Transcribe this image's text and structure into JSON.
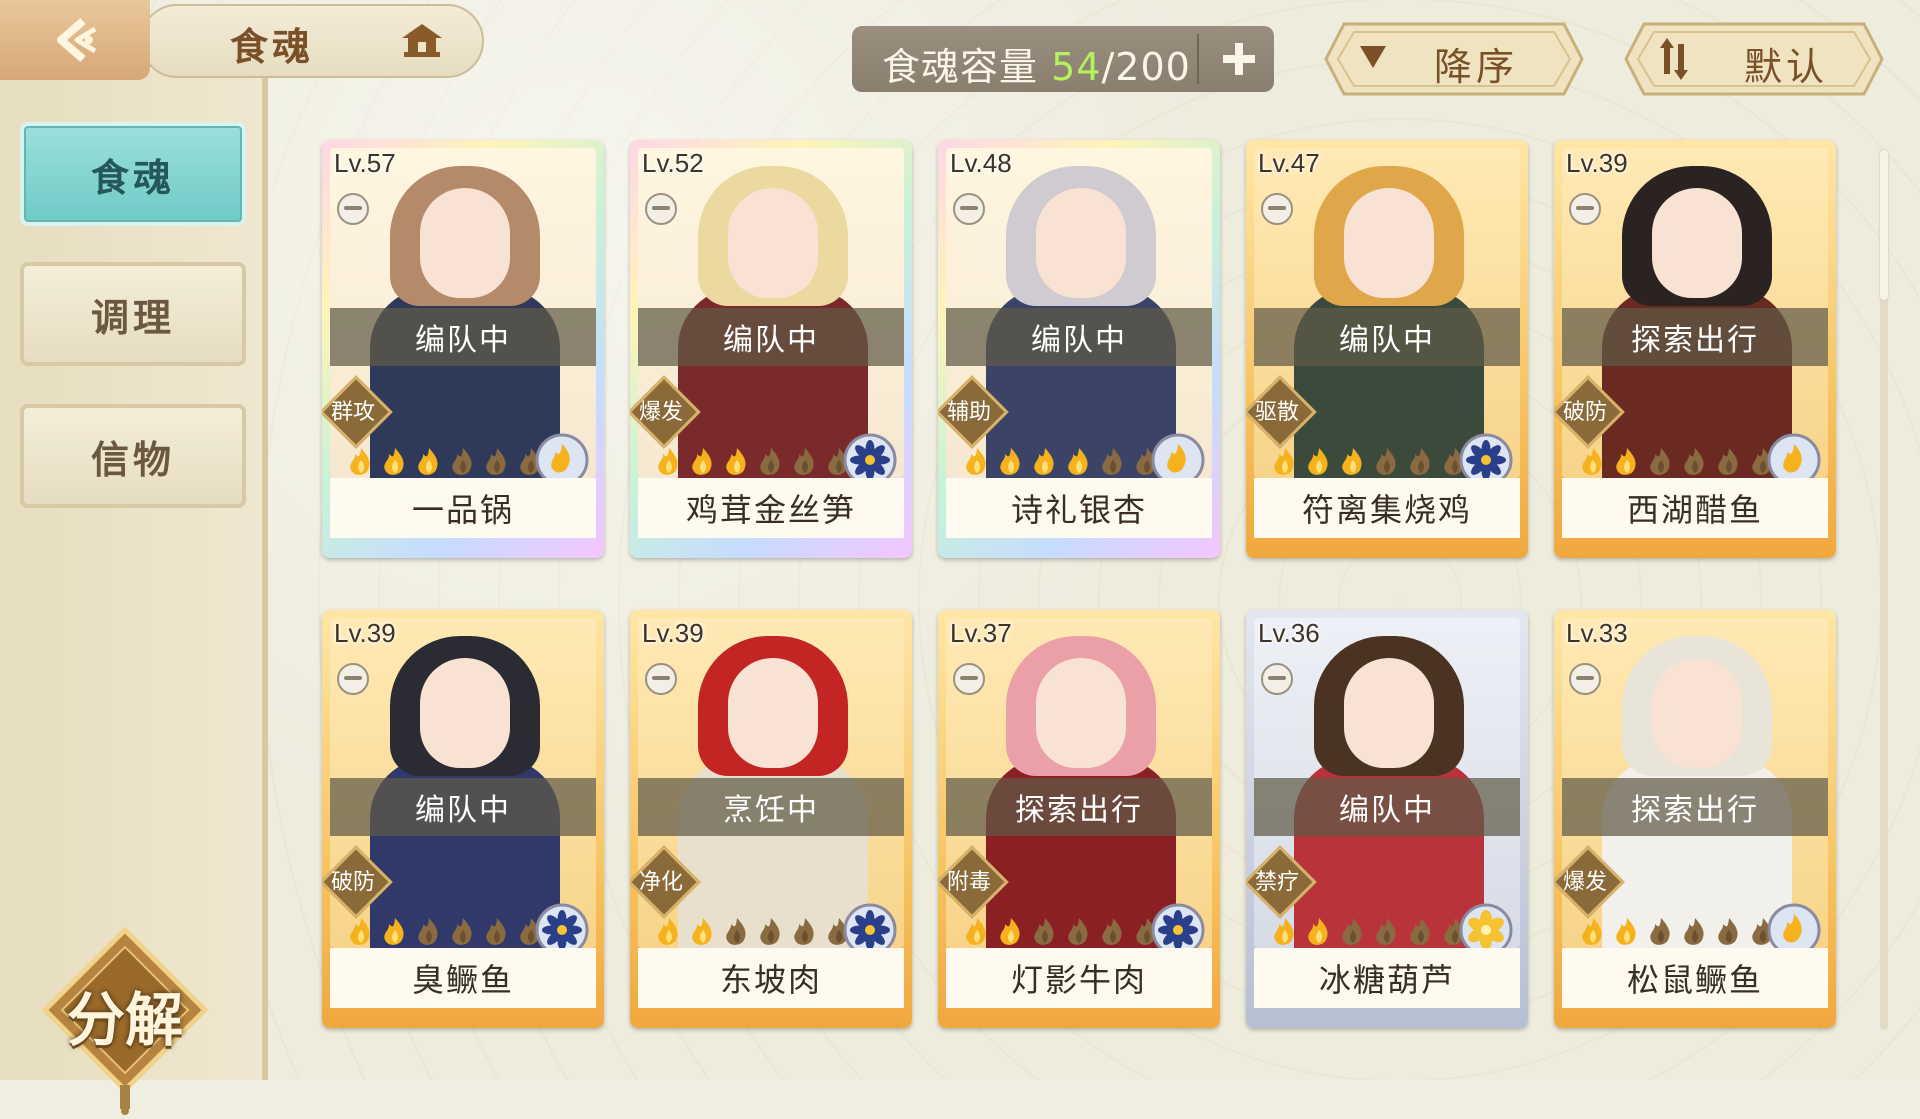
{
  "header": {
    "title": "食魂",
    "capacity_label": "食魂容量",
    "capacity_current": "54",
    "capacity_max": "/200",
    "sort_order_label": "降序",
    "sort_mode_label": "默认"
  },
  "sidebar": {
    "tabs": [
      {
        "label": "食魂",
        "active": true
      },
      {
        "label": "调理",
        "active": false
      },
      {
        "label": "信物",
        "active": false
      }
    ],
    "decompose_label": "分解"
  },
  "colors": {
    "accent_teal": "#6fcac4",
    "capacity_green": "#b3f25e",
    "brown_text": "#7a5028"
  },
  "cards": [
    {
      "level": "Lv.57",
      "status": "编队中",
      "role": "群攻",
      "name": "一品锅",
      "stars": 3,
      "rarity": "rainbow",
      "emblem": "flame",
      "hair": "#b48a6a",
      "outfit": "#2f3a5a"
    },
    {
      "level": "Lv.52",
      "status": "编队中",
      "role": "爆发",
      "name": "鸡茸金丝笋",
      "stars": 3,
      "rarity": "rainbow",
      "emblem": "flower",
      "hair": "#ecd9a0",
      "outfit": "#7a2a2a"
    },
    {
      "level": "Lv.48",
      "status": "编队中",
      "role": "辅助",
      "name": "诗礼银杏",
      "stars": 4,
      "rarity": "rainbow",
      "emblem": "flame",
      "hair": "#cfcbd0",
      "outfit": "#3b4366"
    },
    {
      "level": "Lv.47",
      "status": "编队中",
      "role": "驱散",
      "name": "符离集烧鸡",
      "stars": 3,
      "rarity": "gold",
      "emblem": "flower",
      "hair": "#e0a64a",
      "outfit": "#3b4a3a"
    },
    {
      "level": "Lv.39",
      "status": "探索出行",
      "role": "破防",
      "name": "西湖醋鱼",
      "stars": 2,
      "rarity": "gold",
      "emblem": "flame",
      "hair": "#2a2322",
      "outfit": "#6a2a22"
    },
    {
      "level": "Lv.39",
      "status": "编队中",
      "role": "破防",
      "name": "臭鳜鱼",
      "stars": 2,
      "rarity": "gold",
      "emblem": "flower",
      "hair": "#2b2b33",
      "outfit": "#31386a"
    },
    {
      "level": "Lv.39",
      "status": "烹饪中",
      "role": "净化",
      "name": "东坡肉",
      "stars": 2,
      "rarity": "gold",
      "emblem": "flower",
      "hair": "#c32525",
      "outfit": "#e8e0cc"
    },
    {
      "level": "Lv.37",
      "status": "探索出行",
      "role": "附毒",
      "name": "灯影牛肉",
      "stars": 2,
      "rarity": "gold",
      "emblem": "flower",
      "hair": "#eba0a8",
      "outfit": "#8a1f24"
    },
    {
      "level": "Lv.36",
      "status": "编队中",
      "role": "禁疗",
      "name": "冰糖葫芦",
      "stars": 2,
      "rarity": "silver",
      "emblem": "flower-gold",
      "hair": "#4a3322",
      "outfit": "#b8343a"
    },
    {
      "level": "Lv.33",
      "status": "探索出行",
      "role": "爆发",
      "name": "松鼠鳜鱼",
      "stars": 2,
      "rarity": "gold",
      "emblem": "flame",
      "hair": "#e8e4d8",
      "outfit": "#f2f0ea"
    }
  ]
}
